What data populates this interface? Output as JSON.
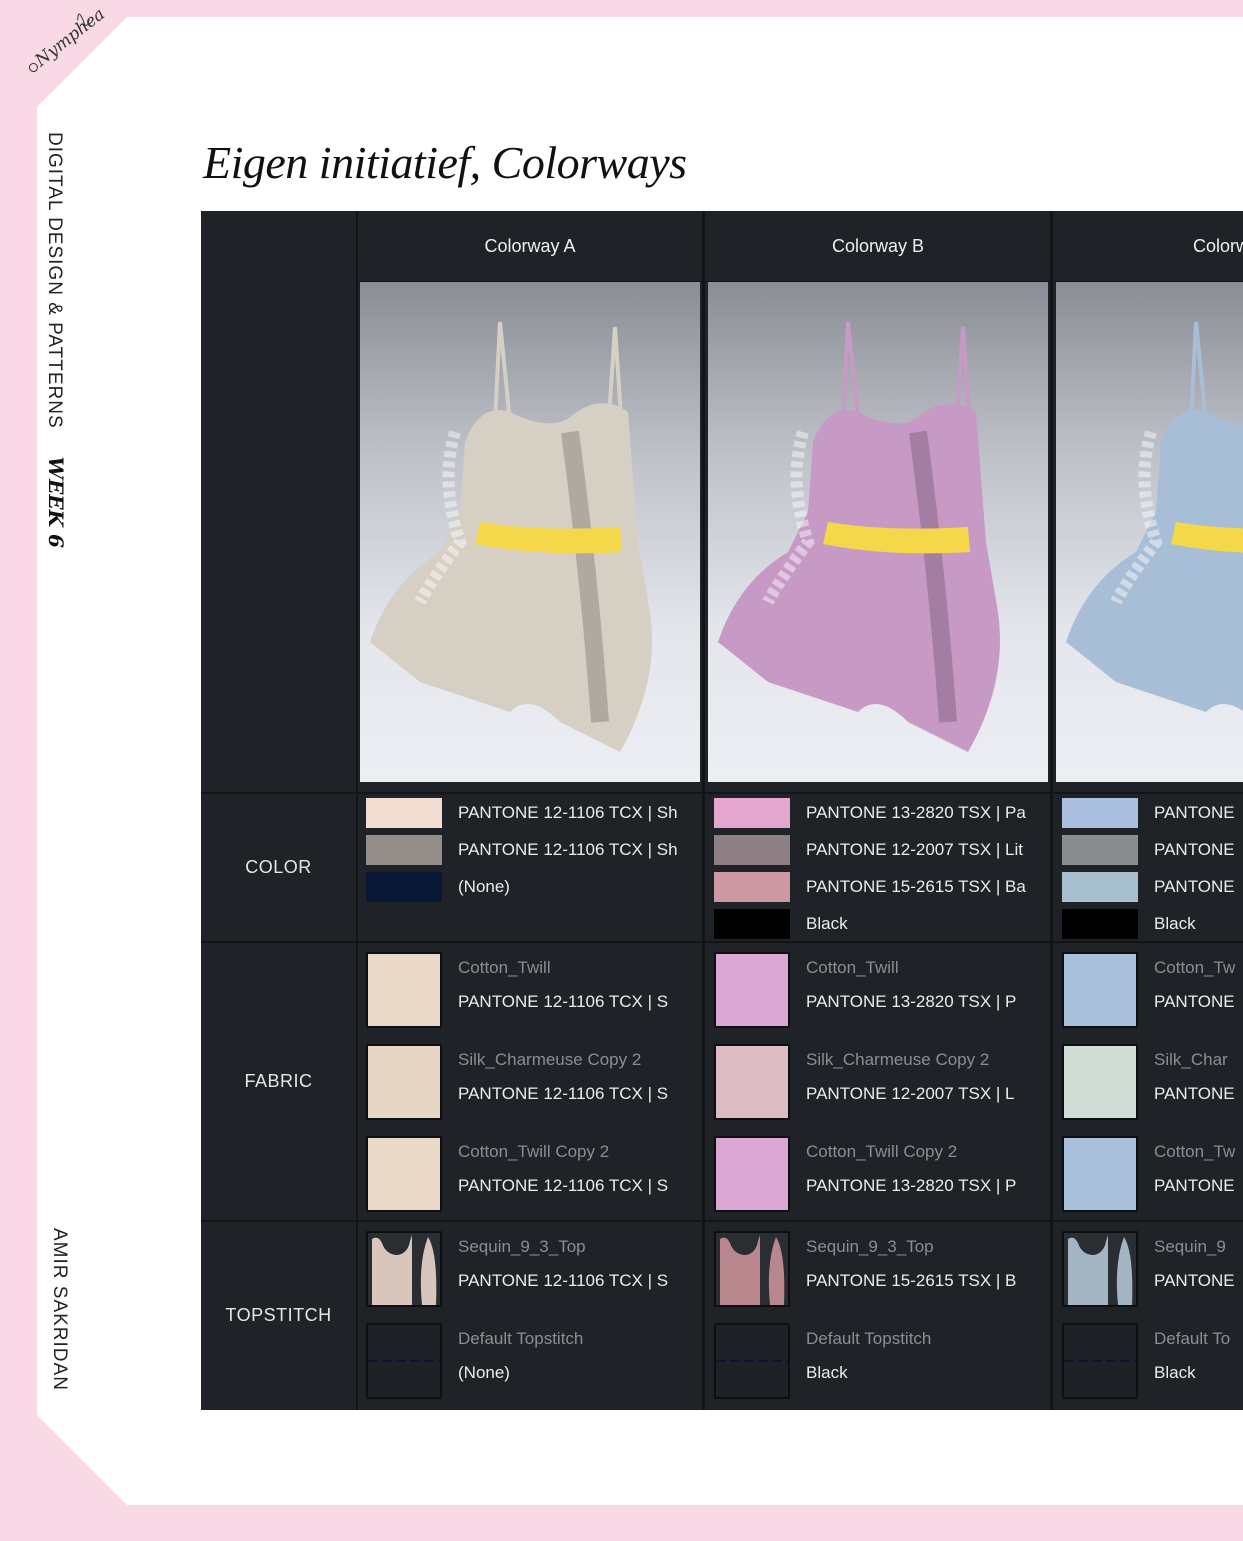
{
  "logo_text": "Nymphea",
  "sidebar": {
    "section": "DIGITAL DESIGN & PATTERNS",
    "week": "WEEK 6",
    "author": "AMIR SAKRIDAN"
  },
  "title": "Eigen initiatief, Colorways",
  "row_labels": {
    "color": "COLOR",
    "fabric": "FABRIC",
    "topstitch": "TOPSTITCH"
  },
  "colorways": [
    {
      "name": "Colorway A",
      "garment_color": "#d6cfc3",
      "colors": [
        {
          "swatch": "#f1ddd2",
          "label": "PANTONE 12-1106 TCX | Sh"
        },
        {
          "swatch": "#958d8a",
          "label": "PANTONE 12-1106 TCX | Sh"
        },
        {
          "swatch": "#0a1838",
          "label": "(None)"
        }
      ],
      "fabrics": [
        {
          "swatch": "#ead9c8",
          "name": "Cotton_Twill",
          "pantone": "PANTONE 12-1106 TCX | S"
        },
        {
          "swatch": "#e7d6c5",
          "name": "Silk_Charmeuse Copy 2",
          "pantone": "PANTONE 12-1106 TCX | S"
        },
        {
          "swatch": "#ead9c8",
          "name": "Cotton_Twill Copy 2",
          "pantone": "PANTONE 12-1106 TCX | S"
        }
      ],
      "topstitch": [
        {
          "swatch": "#d8c6bc",
          "name": "Sequin_9_3_Top",
          "pantone": "PANTONE 12-1106 TCX | S"
        },
        {
          "swatch": "#1e2126",
          "name": "Default Topstitch",
          "pantone": "(None)"
        }
      ]
    },
    {
      "name": "Colorway B",
      "garment_color": "#c79ac6",
      "colors": [
        {
          "swatch": "#e2a6cf",
          "label": "PANTONE 13-2820 TSX | Pa"
        },
        {
          "swatch": "#8e7f84",
          "label": "PANTONE 12-2007 TSX | Lit"
        },
        {
          "swatch": "#cd98a4",
          "label": "PANTONE 15-2615 TSX | Ba"
        },
        {
          "swatch": "#000000",
          "label": "Black"
        }
      ],
      "fabrics": [
        {
          "swatch": "#dba8d3",
          "name": "Cotton_Twill",
          "pantone": "PANTONE 13-2820 TSX | P"
        },
        {
          "swatch": "#ddbcc3",
          "name": "Silk_Charmeuse Copy 2",
          "pantone": "PANTONE 12-2007 TSX | L"
        },
        {
          "swatch": "#dba8d3",
          "name": "Cotton_Twill Copy 2",
          "pantone": "PANTONE 13-2820 TSX | P"
        }
      ],
      "topstitch": [
        {
          "swatch": "#b8878e",
          "name": "Sequin_9_3_Top",
          "pantone": "PANTONE 15-2615 TSX | B"
        },
        {
          "swatch": "#1e2126",
          "name": "Default Topstitch",
          "pantone": "Black"
        }
      ]
    },
    {
      "name": "Colorwa",
      "garment_color": "#a8bdd6",
      "colors": [
        {
          "swatch": "#aabfdf",
          "label": "PANTONE"
        },
        {
          "swatch": "#8a8c8f",
          "label": "PANTONE"
        },
        {
          "swatch": "#a8bfcd",
          "label": "PANTONE"
        },
        {
          "swatch": "#000000",
          "label": "Black"
        }
      ],
      "fabrics": [
        {
          "swatch": "#a9c0dc",
          "name": "Cotton_Tw",
          "pantone": "PANTONE"
        },
        {
          "swatch": "#cfddd6",
          "name": "Silk_Char",
          "pantone": "PANTONE"
        },
        {
          "swatch": "#a9c0dc",
          "name": "Cotton_Tw",
          "pantone": "PANTONE"
        }
      ],
      "topstitch": [
        {
          "swatch": "#a3b4c2",
          "name": "Sequin_9",
          "pantone": "PANTONE"
        },
        {
          "swatch": "#1e2126",
          "name": "Default To",
          "pantone": "Black"
        }
      ]
    }
  ]
}
